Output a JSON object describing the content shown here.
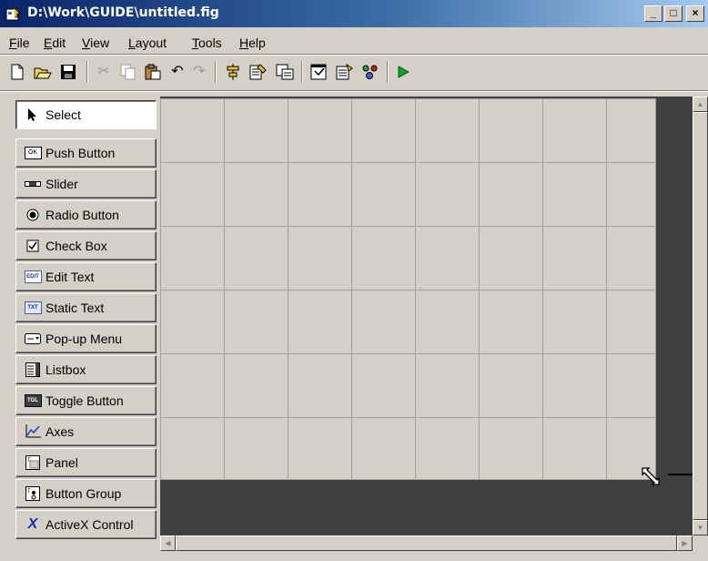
{
  "window": {
    "title": "D:\\Work\\GUIDE\\untitled.fig"
  },
  "menu": [
    {
      "label": "File",
      "key": "F",
      "rest": "ile"
    },
    {
      "label": "Edit",
      "key": "E",
      "rest": "dit"
    },
    {
      "label": "View",
      "key": "V",
      "rest": "iew"
    },
    {
      "label": "Layout",
      "key": "L",
      "rest": "ayout"
    },
    {
      "label": "Tools",
      "key": "T",
      "rest": "ools"
    },
    {
      "label": "Help",
      "key": "H",
      "rest": "elp"
    }
  ],
  "toolbar": [
    {
      "name": "new-figure",
      "icon": "new-document-icon"
    },
    {
      "name": "open-file",
      "icon": "open-folder-icon"
    },
    {
      "name": "save-figure",
      "icon": "save-disk-icon"
    },
    {
      "name": "cut",
      "icon": "scissors-icon"
    },
    {
      "name": "copy",
      "icon": "copy-icon"
    },
    {
      "name": "paste",
      "icon": "paste-icon"
    },
    {
      "name": "undo",
      "icon": "undo-icon"
    },
    {
      "name": "redo",
      "icon": "redo-icon"
    },
    {
      "name": "align-objects",
      "icon": "align-icon"
    },
    {
      "name": "menu-editor",
      "icon": "menu-editor-icon"
    },
    {
      "name": "tab-order-editor",
      "icon": "tab-order-icon"
    },
    {
      "name": "m-file-editor",
      "icon": "editor-icon"
    },
    {
      "name": "property-inspector",
      "icon": "property-inspector-icon"
    },
    {
      "name": "object-browser",
      "icon": "object-browser-icon"
    },
    {
      "name": "run-figure",
      "icon": "run-icon"
    }
  ],
  "palette": [
    {
      "label": "Select",
      "icon": "arrow-cursor-icon",
      "selected": true
    },
    {
      "label": "Push Button",
      "icon": "push-button-icon"
    },
    {
      "label": "Slider",
      "icon": "slider-icon"
    },
    {
      "label": "Radio Button",
      "icon": "radio-button-icon"
    },
    {
      "label": "Check Box",
      "icon": "checkbox-icon"
    },
    {
      "label": "Edit Text",
      "icon": "edit-text-icon"
    },
    {
      "label": "Static Text",
      "icon": "static-text-icon"
    },
    {
      "label": "Pop-up Menu",
      "icon": "popup-menu-icon"
    },
    {
      "label": "Listbox",
      "icon": "listbox-icon"
    },
    {
      "label": "Toggle Button",
      "icon": "toggle-button-icon"
    },
    {
      "label": "Axes",
      "icon": "axes-icon"
    },
    {
      "label": "Panel",
      "icon": "panel-icon"
    },
    {
      "label": "Button Group",
      "icon": "button-group-icon"
    },
    {
      "label": "ActiveX Control",
      "icon": "activex-icon"
    }
  ],
  "icon_text": {
    "push_button": "OK",
    "edit_text": "EDIT",
    "static_text": "TXT",
    "toggle_button": "TGL",
    "activex": "X"
  },
  "colors": {
    "title_start": "#0a246a",
    "title_end": "#a6caf0",
    "chrome": "#d4d0c8",
    "canvas_bg": "#404040",
    "grid_line": "#a0a0a0"
  }
}
